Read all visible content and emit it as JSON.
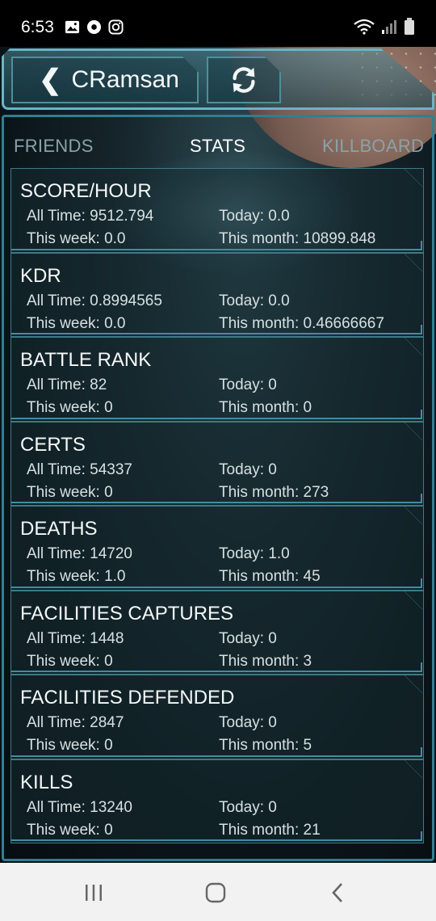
{
  "status_bar": {
    "time": "6:53",
    "left_icons": [
      "gallery-icon",
      "media-icon",
      "instagram-icon"
    ],
    "right_icons": [
      "wifi-icon",
      "signal-icon",
      "battery-icon"
    ]
  },
  "header": {
    "back_chevron": "❮",
    "title": "CRamsan",
    "accent_color": "#6ab4c4"
  },
  "tabs": [
    {
      "label": "FRIENDS",
      "selected": false
    },
    {
      "label": "STATS",
      "selected": true
    },
    {
      "label": "KILLBOARD",
      "selected": false
    }
  ],
  "stats": [
    {
      "title": "SCORE/HOUR",
      "all_time": "All Time: 9512.794",
      "today": "Today: 0.0",
      "week": "This week: 0.0",
      "month": "This month: 10899.848"
    },
    {
      "title": "KDR",
      "all_time": "All Time: 0.8994565",
      "today": "Today: 0.0",
      "week": "This week: 0.0",
      "month": "This month: 0.46666667"
    },
    {
      "title": "BATTLE RANK",
      "all_time": "All Time: 82",
      "today": "Today: 0",
      "week": "This week: 0",
      "month": "This month: 0"
    },
    {
      "title": "CERTS",
      "all_time": "All Time: 54337",
      "today": "Today: 0",
      "week": "This week: 0",
      "month": "This month: 273"
    },
    {
      "title": "DEATHS",
      "all_time": "All Time: 14720",
      "today": "Today: 1.0",
      "week": "This week: 1.0",
      "month": "This month: 45"
    },
    {
      "title": "FACILITIES CAPTURES",
      "all_time": "All Time: 1448",
      "today": "Today: 0",
      "week": "This week: 0",
      "month": "This month: 3"
    },
    {
      "title": "FACILITIES DEFENDED",
      "all_time": "All Time: 2847",
      "today": "Today: 0",
      "week": "This week: 0",
      "month": "This month: 5"
    },
    {
      "title": "KILLS",
      "all_time": "All Time: 13240",
      "today": "Today: 0",
      "week": "This week: 0",
      "month": "This month: 21"
    }
  ],
  "nav_bar": {
    "buttons": [
      "recents-icon",
      "home-icon",
      "back-icon"
    ]
  }
}
